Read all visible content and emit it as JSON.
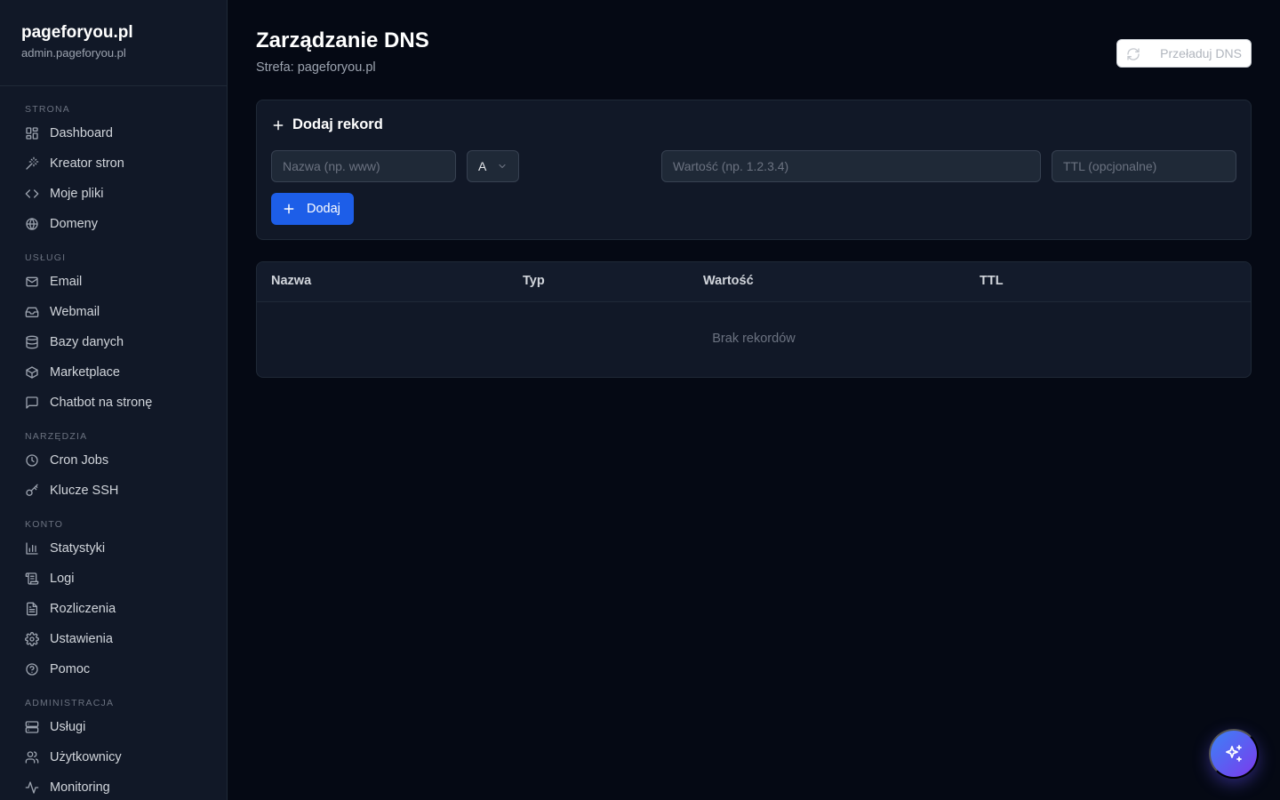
{
  "brand": {
    "title": "pageforyou.pl",
    "subtitle": "admin.pageforyou.pl"
  },
  "sidebar": {
    "sections": [
      {
        "label": "STRONA",
        "items": [
          {
            "label": "Dashboard",
            "icon": "grid-icon"
          },
          {
            "label": "Kreator stron",
            "icon": "magic-wand-icon"
          },
          {
            "label": "Moje pliki",
            "icon": "code-icon"
          },
          {
            "label": "Domeny",
            "icon": "globe-icon"
          }
        ]
      },
      {
        "label": "USŁUGI",
        "items": [
          {
            "label": "Email",
            "icon": "mail-icon"
          },
          {
            "label": "Webmail",
            "icon": "inbox-icon"
          },
          {
            "label": "Bazy danych",
            "icon": "database-icon"
          },
          {
            "label": "Marketplace",
            "icon": "package-icon"
          },
          {
            "label": "Chatbot na stronę",
            "icon": "chat-icon"
          }
        ]
      },
      {
        "label": "NARZĘDZIA",
        "items": [
          {
            "label": "Cron Jobs",
            "icon": "clock-icon"
          },
          {
            "label": "Klucze SSH",
            "icon": "key-icon"
          }
        ]
      },
      {
        "label": "KONTO",
        "items": [
          {
            "label": "Statystyki",
            "icon": "bar-chart-icon"
          },
          {
            "label": "Logi",
            "icon": "scroll-icon"
          },
          {
            "label": "Rozliczenia",
            "icon": "file-text-icon"
          },
          {
            "label": "Ustawienia",
            "icon": "gear-icon"
          },
          {
            "label": "Pomoc",
            "icon": "help-circle-icon"
          }
        ]
      },
      {
        "label": "ADMINISTRACJA",
        "items": [
          {
            "label": "Usługi",
            "icon": "server-icon"
          },
          {
            "label": "Użytkownicy",
            "icon": "users-icon"
          },
          {
            "label": "Monitoring",
            "icon": "activity-icon"
          }
        ]
      }
    ]
  },
  "header": {
    "title": "Zarządzanie DNS",
    "subtitle": "Strefa: pageforyou.pl",
    "reload_label": "Przeładuj DNS"
  },
  "add_record": {
    "title": "Dodaj rekord",
    "name_placeholder": "Nazwa (np. www)",
    "type_value": "A",
    "value_placeholder": "Wartość (np. 1.2.3.4)",
    "ttl_placeholder": "TTL (opcjonalne)",
    "add_label": "Dodaj"
  },
  "records_table": {
    "columns": [
      "Nazwa",
      "Typ",
      "Wartość",
      "TTL"
    ],
    "rows": [],
    "empty_text": "Brak rekordów"
  },
  "colors": {
    "accent": "#1d5ee8",
    "background": "#050914",
    "panel": "#111827"
  }
}
